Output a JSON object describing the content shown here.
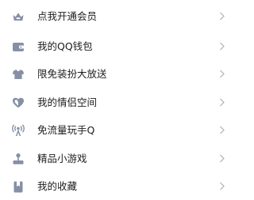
{
  "colors": {
    "icon": "#8590a6",
    "text": "#1c1c1c",
    "chevron": "#b8b8b8",
    "background": "#ffffff"
  },
  "menu": {
    "items": [
      {
        "label": "点我开通会员",
        "icon": "crown-icon"
      },
      {
        "label": "我的QQ钱包",
        "icon": "wallet-icon"
      },
      {
        "label": "限免装扮大放送",
        "icon": "tshirt-icon"
      },
      {
        "label": "我的情侣空间",
        "icon": "heart-icon"
      },
      {
        "label": "免流量玩手Q",
        "icon": "signal-tower-icon"
      },
      {
        "label": "精品小游戏",
        "icon": "joystick-icon"
      },
      {
        "label": "我的收藏",
        "icon": "bookmark-icon"
      }
    ]
  }
}
